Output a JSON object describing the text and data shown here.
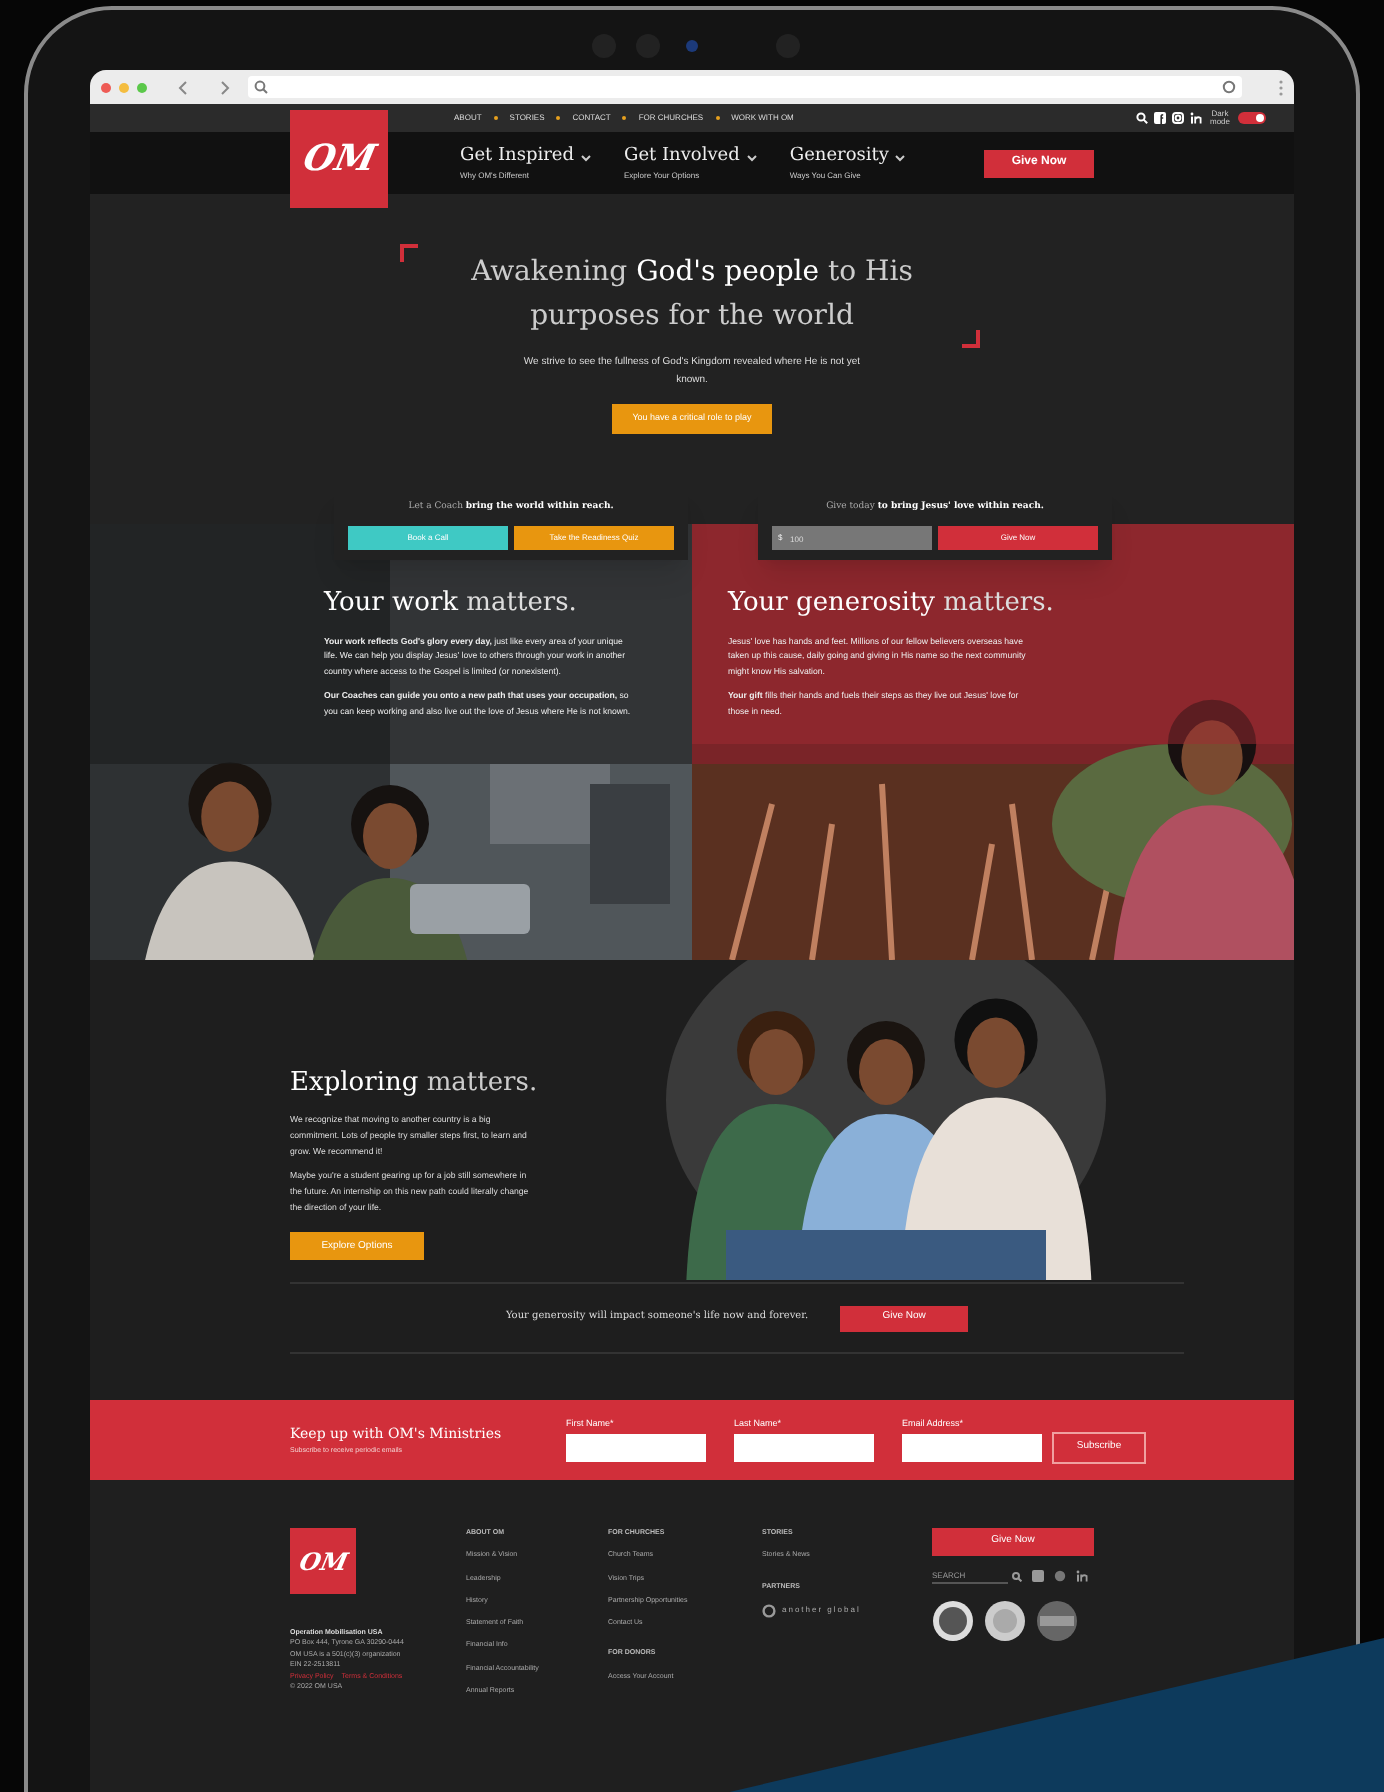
{
  "utility_nav": {
    "links": [
      "ABOUT",
      "STORIES",
      "CONTACT",
      "FOR CHURCHES",
      "WORK WITH OM"
    ],
    "dark_mode_label": "Dark mode",
    "dark_mode": true
  },
  "logo": {
    "text": "OM"
  },
  "main_nav": [
    {
      "label": "Get Inspired",
      "sub": "Why OM's Different"
    },
    {
      "label": "Get Involved",
      "sub": "Explore Your Options"
    },
    {
      "label": "Generosity",
      "sub": "Ways You Can Give"
    }
  ],
  "nav_button": "Give Now",
  "hero": {
    "heading": "Awakening **God's people** to His purposes for the world",
    "text": "We strive to see the fullness of God's Kingdom revealed where He is not yet known.",
    "button": "You have a critical role to play"
  },
  "cta_cards": [
    {
      "text": "Let a Coach **bring the world within reach.**",
      "buttons": [
        {
          "label": "Book a Call",
          "kind": "teal"
        },
        {
          "label": "Take the Readiness Quiz",
          "kind": "orange"
        }
      ]
    },
    {
      "text": "Give today **to bring Jesus' love within reach.**",
      "amount": {
        "prefix": "$",
        "placeholder": "100"
      },
      "button": "Give Now"
    }
  ],
  "panels": [
    {
      "heading": "**Your work** matters.",
      "paragraphs": [
        "**Your work reflects God's glory every day,** just like every area of your unique life. We can help you display Jesus' love to others through your work in another country where access to the Gospel is limited (or nonexistent).",
        "**Our Coaches can guide you onto a new path that uses your occupation,** so you can keep working and also live out the love of Jesus where He is not known."
      ]
    },
    {
      "heading": "**Your generosity** matters.",
      "paragraphs": [
        "Jesus' love has hands and feet. Millions of our fellow believers overseas have taken up this cause, daily going and giving in His name so the next community might know His salvation.",
        "**Your gift** fills their hands and fuels their steps as they live out Jesus' love for those in need."
      ]
    }
  ],
  "exploring": {
    "heading": "**Exploring** matters.",
    "paragraphs": [
      "We recognize that moving to another country is a big commitment. Lots of people try smaller steps first, to learn and grow. We recommend it!",
      "Maybe you're a student gearing up for a job still somewhere in the future. An internship on this new path could literally change the direction of your life."
    ],
    "button": "Explore Options"
  },
  "give_row": {
    "text": "Your generosity will impact someone's life now and forever.",
    "button": "Give Now"
  },
  "newsletter": {
    "title": "Keep up with OM's Ministries",
    "subtitle": "Subscribe to receive periodic emails",
    "fields": [
      "First Name*",
      "Last Name*",
      "Email Address*"
    ],
    "button": "Subscribe"
  },
  "footer": {
    "logo_text": "OM",
    "org": "Operation Mobilisation USA",
    "address": [
      "PO Box 444, Tyrone GA 30290-0444",
      "OM USA is a 501(c)(3) organization",
      "EIN 22-2513811"
    ],
    "legal_links": [
      "Privacy Policy",
      "Terms & Conditions"
    ],
    "copyright": "© 2022 OM USA",
    "columns": [
      {
        "groups": [
          {
            "title": "ABOUT OM",
            "links": [
              "Mission & Vision",
              "Leadership",
              "History",
              "Statement of Faith",
              "Financial Info",
              "Financial Accountability",
              "Annual Reports"
            ]
          }
        ]
      },
      {
        "groups": [
          {
            "title": "FOR CHURCHES",
            "links": [
              "Church Teams",
              "Vision Trips",
              "Partnership Opportunities",
              "Contact Us"
            ]
          },
          {
            "title": "FOR DONORS",
            "links": [
              "Access Your Account"
            ]
          }
        ]
      },
      {
        "groups": [
          {
            "title": "STORIES",
            "links": [
              "Stories & News"
            ]
          },
          {
            "title": "PARTNERS",
            "links": [
              "another global"
            ]
          }
        ]
      }
    ],
    "button": "Give Now",
    "search_placeholder": "SEARCH"
  }
}
